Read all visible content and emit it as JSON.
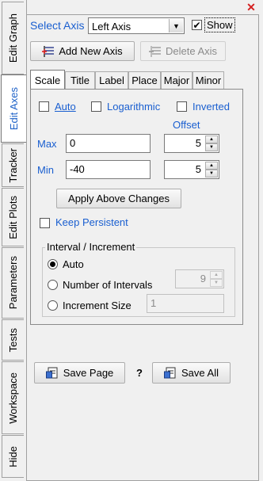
{
  "vertical_tabs": [
    {
      "label": "Edit Graph",
      "active": false
    },
    {
      "label": "Edit Axes",
      "active": true
    },
    {
      "label": "Tracker",
      "active": false
    },
    {
      "label": "Edit Plots",
      "active": false
    },
    {
      "label": "Parameters",
      "active": false
    },
    {
      "label": "Tests",
      "active": false
    },
    {
      "label": "Workspace",
      "active": false
    },
    {
      "label": "Hide",
      "active": false
    }
  ],
  "header": {
    "select_axis_label": "Select Axis",
    "select_axis_value": "Left Axis",
    "show_label": "Show",
    "show_checked": true
  },
  "toolbar": {
    "add_axis_label": "Add New Axis",
    "delete_axis_label": "Delete Axis"
  },
  "subtabs": [
    "Scale",
    "Title",
    "Label",
    "Place",
    "Major",
    "Minor"
  ],
  "active_subtab": "Scale",
  "scale": {
    "auto_label": "Auto",
    "auto_checked": false,
    "log_label": "Logarithmic",
    "log_checked": false,
    "inverted_label": "Inverted",
    "inverted_checked": false,
    "offset_label": "Offset",
    "max_label": "Max",
    "max_value": "0",
    "max_offset": "5",
    "min_label": "Min",
    "min_value": "-40",
    "min_offset": "5",
    "apply_label": "Apply Above Changes",
    "keep_label": "Keep Persistent",
    "keep_checked": false
  },
  "interval": {
    "group_label": "Interval / Increment",
    "auto_label": "Auto",
    "count_label": "Number of Intervals",
    "count_value": "9",
    "size_label": "Increment Size",
    "size_value": "1",
    "selected": "auto"
  },
  "footer": {
    "save_page_label": "Save Page",
    "help_label": "?",
    "save_all_label": "Save All"
  },
  "close_symbol": "✕",
  "colors": {
    "accent_blue": "#1a5fd0",
    "close_red": "#d42020"
  }
}
